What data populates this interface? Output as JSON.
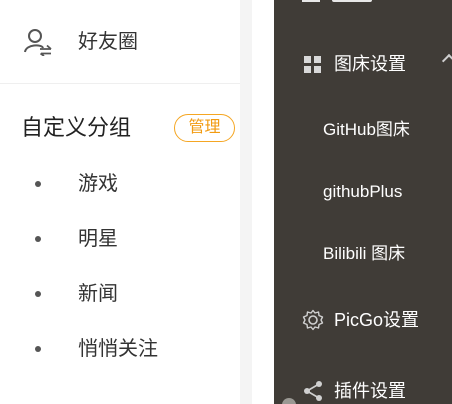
{
  "left_panel": {
    "friends": {
      "label": "好友圈",
      "icon": "user-switch-icon"
    },
    "group": {
      "title": "自定义分组",
      "manage_label": "管理",
      "items": [
        {
          "label": "游戏"
        },
        {
          "label": "明星"
        },
        {
          "label": "新闻"
        },
        {
          "label": "悄悄关注"
        }
      ]
    }
  },
  "menu": {
    "image_host_settings": {
      "label": "图床设置",
      "icon": "grid-icon"
    },
    "submenu": [
      {
        "label": "GitHub图床"
      },
      {
        "label": "githubPlus"
      },
      {
        "label": "Bilibili 图床"
      }
    ],
    "picgo_settings": {
      "label": "PicGo设置",
      "icon": "gear-icon"
    },
    "plugin_settings": {
      "label": "插件设置",
      "icon": "share-icon"
    }
  },
  "colors": {
    "menu_background": "#403c37",
    "accent_orange": "#f29b11",
    "left_background": "#ffffff"
  }
}
